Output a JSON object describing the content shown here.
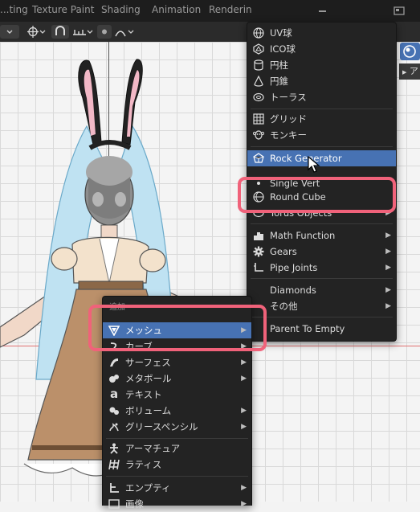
{
  "topbar": {
    "tabs": [
      "...ting",
      "Texture Paint",
      "Shading",
      "Animation",
      "Renderin"
    ],
    "window_icons": [
      "minimize-icon",
      "maximize-icon",
      "close-icon"
    ]
  },
  "toolbar": {
    "icons": [
      "transform-orientation-icon",
      "pivot-point-icon",
      "snap-icon",
      "snap-increment-icon",
      "proportional-edit-icon",
      "falloff-icon"
    ],
    "sidebar_tab": "ア"
  },
  "add_menu": {
    "header": "追加",
    "items": [
      {
        "label": "メッシュ",
        "icon": "mesh-icon",
        "submenu": true,
        "highlighted": true
      },
      {
        "label": "カーブ",
        "icon": "curve-icon",
        "submenu": true
      },
      {
        "label": "サーフェス",
        "icon": "surface-icon",
        "submenu": true
      },
      {
        "label": "メタボール",
        "icon": "metaball-icon",
        "submenu": true
      },
      {
        "label": "テキスト",
        "icon": "text-icon",
        "submenu": false
      },
      {
        "label": "ボリューム",
        "icon": "volume-icon",
        "submenu": true
      },
      {
        "label": "グリースペンシル",
        "icon": "grease-pencil-icon",
        "submenu": true
      },
      {
        "label": "アーマチュア",
        "icon": "armature-icon",
        "submenu": false
      },
      {
        "label": "ラティス",
        "icon": "lattice-icon",
        "submenu": false
      },
      {
        "label": "エンプティ",
        "icon": "empty-icon",
        "submenu": true
      },
      {
        "label": "画像",
        "icon": "image-icon",
        "submenu": true
      }
    ]
  },
  "mesh_menu": {
    "items": [
      {
        "label": "UV球",
        "icon": "uv-sphere-icon"
      },
      {
        "label": "ICO球",
        "icon": "ico-sphere-icon"
      },
      {
        "label": "円柱",
        "icon": "cylinder-icon"
      },
      {
        "label": "円錐",
        "icon": "cone-icon"
      },
      {
        "label": "トーラス",
        "icon": "torus-icon"
      },
      {
        "label": "グリッド",
        "icon": "grid-icon"
      },
      {
        "label": "モンキー",
        "icon": "monkey-icon"
      },
      {
        "label": "Rock Generator",
        "icon": "rock-icon",
        "highlighted": true
      },
      {
        "label": "Single Vert",
        "icon": "vertex-icon"
      },
      {
        "label": "Round Cube",
        "icon": "round-cube-icon"
      },
      {
        "label": "Torus Objects",
        "icon": "torus-objects-icon",
        "submenu": true
      },
      {
        "label": "Math Function",
        "icon": "math-function-icon",
        "submenu": true
      },
      {
        "label": "Gears",
        "icon": "gear-icon",
        "submenu": true
      },
      {
        "label": "Pipe Joints",
        "icon": "pipe-joints-icon",
        "submenu": true
      },
      {
        "label": "Diamonds",
        "submenu": true
      },
      {
        "label": "その他",
        "submenu": true
      },
      {
        "label": "Parent To Empty"
      }
    ]
  },
  "colors": {
    "menu_bg": "#232323",
    "highlight": "#4772b3",
    "annotation": "#f0627a",
    "axis_x": "#e07070",
    "axis_gizmo_x": "#d3473f",
    "axis_gizmo_y": "#2f9c3a",
    "axis_gizmo_z": "#2c63ae"
  }
}
